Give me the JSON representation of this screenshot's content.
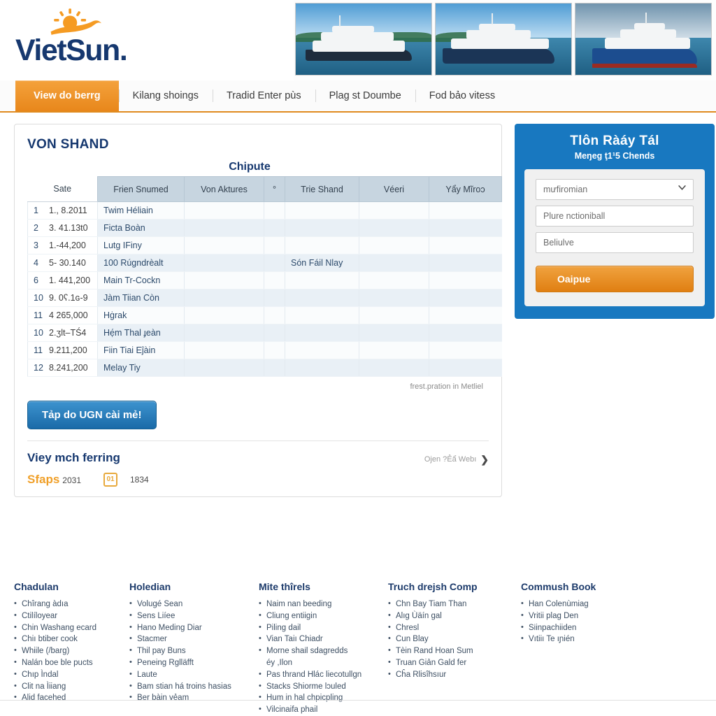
{
  "brand": {
    "name_part1": "Viet",
    "name_part2": "Sun",
    "dot": ".",
    "sun_color": "#f59b23",
    "text_color": "#16386f"
  },
  "banner": {
    "images": [
      "ferry-white-photo",
      "ferry-blue-photo",
      "ferry-navy-photo"
    ]
  },
  "nav": {
    "tabs": [
      {
        "label": "View do berrg",
        "active": true
      },
      {
        "label": "Kilang shoings",
        "active": false
      },
      {
        "label": "Tradid Enter pùs",
        "active": false
      },
      {
        "label": "Plag st Doumbe",
        "active": false
      },
      {
        "label": "Fod bảo vitess",
        "active": false
      }
    ]
  },
  "main": {
    "title": "VON SHAND",
    "table_caption": "Chipute",
    "columns": [
      "Sate",
      "Frien Snumed",
      "Von Aktures",
      "°",
      "Trie Shand",
      "Véeri",
      "Yẩy Mĩroɔ"
    ],
    "rows": [
      {
        "idx": "1",
        "value": "1., 8.2011",
        "name": "Twim Héliain",
        "trie": ""
      },
      {
        "idx": "2",
        "value": "3. 41.13t0",
        "name": "Ficta Boàn",
        "trie": ""
      },
      {
        "idx": "3",
        "value": "1.-44,200",
        "name": "Lutg IFiny",
        "trie": ""
      },
      {
        "idx": "4",
        "value": "5- 30.140",
        "name": "100 Rúgndrèalt",
        "trie": "Són Fáil Nlay"
      },
      {
        "idx": "6",
        "value": "1. 441,200",
        "name": "Main Tr-Cockn",
        "trie": ""
      },
      {
        "idx": "10",
        "value": "9. 0ʕ.1ɢ-9",
        "name": "Jàm Tiian Còn",
        "trie": ""
      },
      {
        "idx": "11",
        "value": "4 265,000",
        "name": "Hġrak",
        "trie": ""
      },
      {
        "idx": "10",
        "value": "2.ʒlt–TŚ4",
        "name": "Hẹ́m Thal ɟeàn",
        "trie": ""
      },
      {
        "idx": "11",
        "value": "9.211,200",
        "name": "Fiin Tiai Eĵàin",
        "trie": ""
      },
      {
        "idx": "12",
        "value": "8.241,200",
        "name": "Melay Tiy",
        "trie": ""
      }
    ],
    "table_note": "frest.pration in Metliel",
    "primary_button": "Tảp do UGN cài mẻ!",
    "sub_title": "Viey mch ferring",
    "sub_link": "Ojen ?Ẻẩ Webı",
    "sub_link_icon": "chevron-right-icon",
    "meta_brand": "Sfaps",
    "meta_brand_num": "2031",
    "meta_badge": "01",
    "meta_badge_num": "1834"
  },
  "sidebar": {
    "title": "Tlôn Ràáy Tál",
    "subtitle": "Meŋeg ţ1¹5 Chends",
    "select_value": "mưfiromian",
    "select_icon": "chevron-down-icon",
    "input1_value": "Plure nctioniball",
    "input2_value": "Beliulve",
    "submit_label": "Oaipue",
    "panel_color": "#1878c0",
    "submit_color": "#e07f12"
  },
  "footer": {
    "columns": [
      {
        "heading": "Chadulan",
        "items": [
          "Chîrang àdıa",
          "Ctilíloyear",
          "Chin Washang ecard",
          "Chiı btiber cook",
          "Whiile (/barg)",
          "Nalán boe ble pucts",
          "Chıp Ìndal",
          "Clit na Ìiiang",
          "Alid facehed"
        ]
      },
      {
        "heading": "Holedian",
        "items": [
          "Volugé Sean",
          "Sens Liíee",
          "Hano Meding Diar",
          "Stacmer",
          "Thil pay Buns",
          "Peneing Rglläfft",
          "Laute",
          "Bam stian há troins hasias",
          "Ber bàin vẻam"
        ]
      },
      {
        "heading": "Mite thîrels",
        "items": [
          "Naim nan beeding",
          "Cliung entiigin",
          "Piling dail",
          "Vian Taiı Chiadr",
          "Morne shaіl sdagredds",
          "éy ,Ilon",
          "Pas thrand Hlác liecotullgn",
          "Stacks Shiorme lɔuled",
          "Hum in hal chpicpling",
          "Vilcinaifa phail"
        ]
      },
      {
        "heading": "Truch drejsh Comp",
        "items": [
          "Chn Bay Tiam Than",
          "Alıg Ùäín gal",
          "Chresl",
          "Cun Blay",
          "Tèin Rand Hoan Sum",
          "Truan Giản Gald fer",
          "Cĥa Rlisîhsıur"
        ]
      },
      {
        "heading": "Commush Book",
        "items": [
          "Han Colenùmiag",
          "Vritii plag Den",
          "Sіinpachiiden",
          "Vıtiiı Te ıɲién"
        ]
      }
    ]
  }
}
